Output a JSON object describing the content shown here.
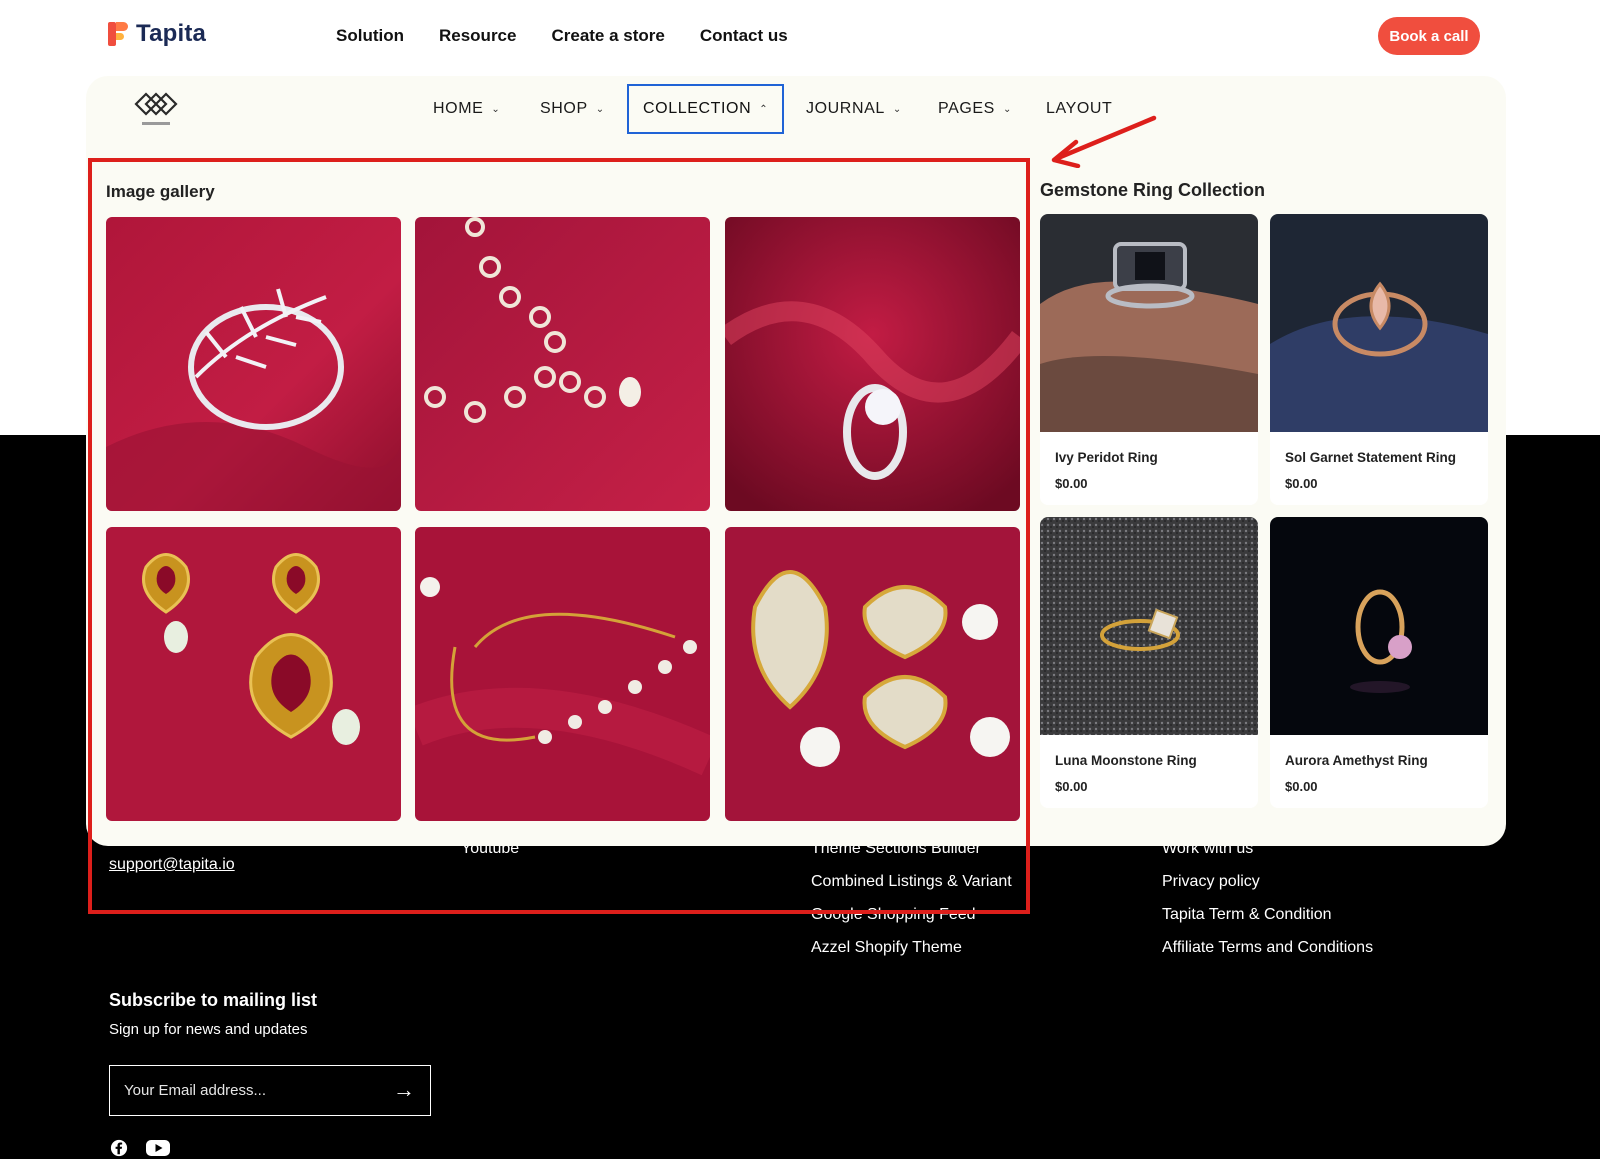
{
  "header": {
    "brand": "Tapita",
    "nav": [
      "Solution",
      "Resource",
      "Create a store",
      "Contact us"
    ],
    "cta": "Book a call"
  },
  "store_nav": {
    "items": [
      {
        "label": "HOME",
        "has_chevron": true
      },
      {
        "label": "SHOP",
        "has_chevron": true
      },
      {
        "label": "COLLECTION",
        "has_chevron": true,
        "active": true
      },
      {
        "label": "JOURNAL",
        "has_chevron": true
      },
      {
        "label": "PAGES",
        "has_chevron": true
      },
      {
        "label": "LAYOUT",
        "has_chevron": false
      }
    ]
  },
  "mega_menu": {
    "gallery_title": "Image gallery",
    "gallery_items": [
      "ring-leaf",
      "necklace",
      "solitaire-ring",
      "ruby-earrings",
      "bracelet",
      "pearl-earrings"
    ],
    "collection_title": "Gemstone Ring Collection",
    "products": [
      {
        "name": "Ivy Peridot Ring",
        "price": "$0.00"
      },
      {
        "name": "Sol Garnet Statement Ring",
        "price": "$0.00"
      },
      {
        "name": "Luna Moonstone Ring",
        "price": "$0.00"
      },
      {
        "name": "Aurora Amethyst Ring",
        "price": "$0.00"
      }
    ]
  },
  "footer": {
    "email": "support@tapita.io",
    "col2_partial": "Youtube",
    "col3": [
      "Theme Sections Builder",
      "Combined Listings & Variant",
      "Google Shopping Feed",
      "Azzel Shopify Theme"
    ],
    "col4": [
      "Work with us",
      "Privacy policy",
      "Tapita Term & Condition",
      "Affiliate Terms and Conditions"
    ],
    "subscribe_title": "Subscribe to mailing list",
    "subscribe_desc": "Sign up for news and updates",
    "email_placeholder": "Your Email address..."
  },
  "colors": {
    "accent": "#f04e3e",
    "active_border": "#1f63d6",
    "highlight": "#dd1f1b",
    "panel_bg": "#fbfbf4"
  }
}
